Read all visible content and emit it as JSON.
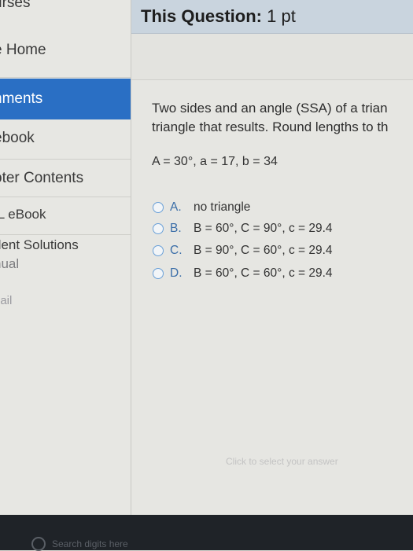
{
  "sidebar": {
    "items": [
      {
        "label": "urses"
      },
      {
        "label": "e Home"
      },
      {
        "label": "nments"
      },
      {
        "label": "ebook"
      },
      {
        "label": "oter Contents"
      },
      {
        "label": "IL eBook"
      },
      {
        "label": "dent Solutions"
      },
      {
        "label": "nual"
      },
      {
        "label": "nail"
      }
    ]
  },
  "header": {
    "title_bold": "This Question:",
    "title_rest": " 1 pt"
  },
  "question": {
    "line1": "Two sides and an angle (SSA) of a trian",
    "line2": "triangle that results. Round lengths to th",
    "given": "A = 30°, a = 17, b = 34",
    "options": [
      {
        "letter": "A.",
        "text": "no triangle"
      },
      {
        "letter": "B.",
        "text": "B = 60°, C = 90°, c = 29.4"
      },
      {
        "letter": "C.",
        "text": "B = 90°, C = 60°, c = 29.4"
      },
      {
        "letter": "D.",
        "text": "B = 60°, C = 60°, c = 29.4"
      }
    ],
    "hint": "Click to select your answer"
  },
  "taskbar": {
    "search_placeholder": "Search digits here"
  },
  "colors": {
    "active_nav": "#2a6fc4",
    "header_bg": "#c9d4de",
    "radio_border": "#6aa0d8"
  }
}
